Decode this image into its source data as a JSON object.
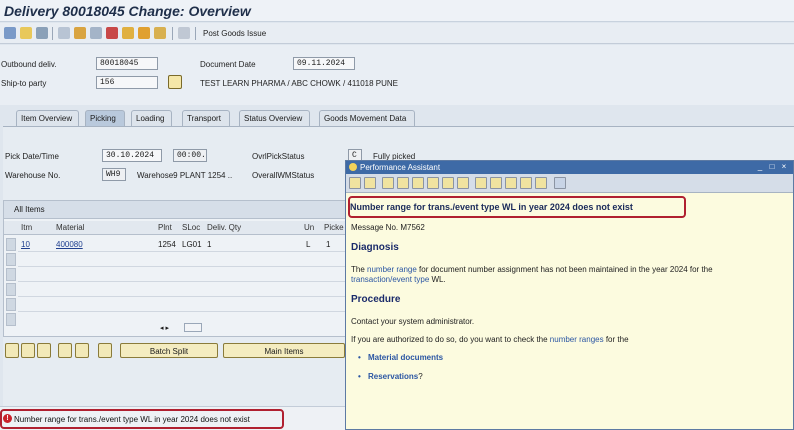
{
  "window": {
    "title": "Delivery 80018045 Change: Overview"
  },
  "toolbar": {
    "post_goods_issue": "Post Goods Issue"
  },
  "header": {
    "outbound_label": "Outbound deliv.",
    "outbound_value": "80018045",
    "docdate_label": "Document Date",
    "docdate_value": "09.11.2024",
    "shipto_label": "Ship-to party",
    "shipto_value": "156",
    "shipto_text": "TEST LEARN PHARMA / ABC CHOWK / 411018 PUNE"
  },
  "tabs": [
    {
      "label": "Item Overview"
    },
    {
      "label": "Picking"
    },
    {
      "label": "Loading"
    },
    {
      "label": "Transport"
    },
    {
      "label": "Status Overview"
    },
    {
      "label": "Goods Movement Data"
    }
  ],
  "picking": {
    "pickdate_label": "Pick Date/Time",
    "pickdate_value": "30.10.2024",
    "picktime_value": "00:00..",
    "ovrl_pick_label": "OvrlPickStatus",
    "ovrl_pick_code": "C",
    "ovrl_pick_text": "Fully picked",
    "warehouse_label": "Warehouse No.",
    "warehouse_value": "WH9",
    "warehouse_text": "Warehose9 PLANT 1254 ..",
    "overall_wm_label": "OverallWMStatus"
  },
  "items": {
    "title": "All Items",
    "columns": [
      "Itm",
      "Material",
      "Plnt",
      "SLoc",
      "Deliv. Qty",
      "Un",
      "Picke"
    ],
    "rows": [
      {
        "itm": "10",
        "material": "400080",
        "plnt": "1254",
        "sloc": "LG01",
        "qty": "1",
        "un": "L",
        "picked": "1"
      }
    ]
  },
  "buttons": {
    "batch_split": "Batch Split",
    "main_items": "Main Items"
  },
  "status": {
    "message": "Number range for trans./event type WL in year 2024 does not exist"
  },
  "assistant": {
    "title": "Performance Assistant",
    "heading": "Number range for trans./event type WL in year 2024 does not exist",
    "message_no": "Message No. M7562",
    "diagnosis_title": "Diagnosis",
    "diag_1": "The ",
    "diag_link1": "number range",
    "diag_2": " for document number assignment has not been maintained in the year 2024 for the",
    "diag_link2": "transaction/event type",
    "diag_3": " WL.",
    "procedure_title": "Procedure",
    "proc_1": "Contact your system administrator.",
    "proc_2a": "If you are authorized to do so, do you want to check the ",
    "proc_2_link": "number ranges",
    "proc_2b": " for the",
    "bullet_1": "Material documents",
    "bullet_2": "Reservations",
    "bullet_2_suffix": "?"
  }
}
